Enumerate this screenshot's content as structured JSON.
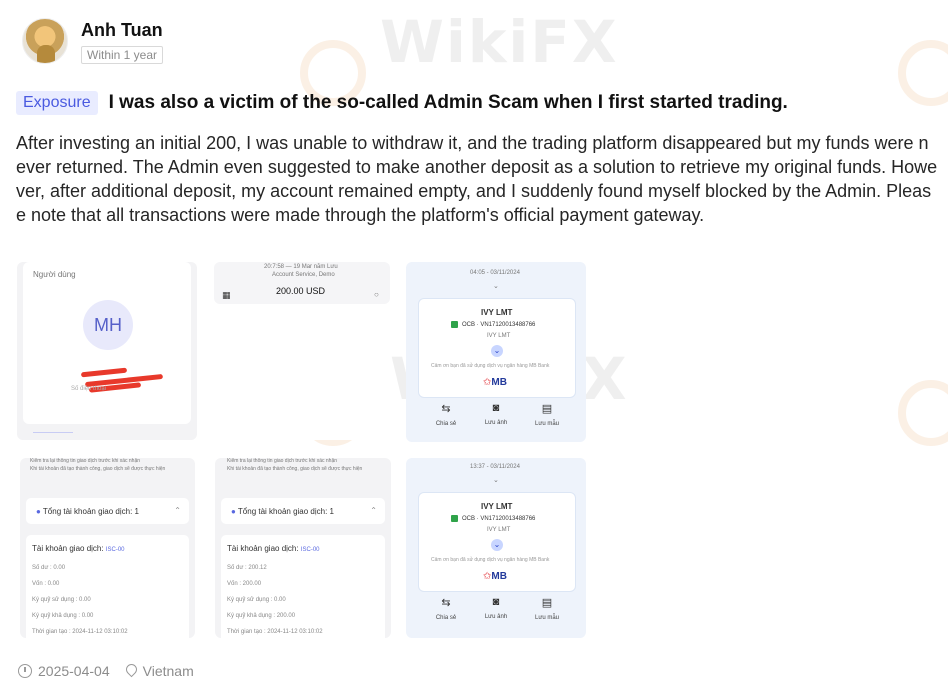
{
  "post": {
    "author": "Anh Tuan",
    "time_badge": "Within 1 year",
    "tag": "Exposure",
    "title": "I was also a victim of the so-called Admin Scam when I first started trading.",
    "body": "After investing an initial 200, I was unable to withdraw it, and the trading platform disappeared but my funds were never returned. The Admin even suggested to make another deposit as a solution to retrieve my original funds. However, after additional deposit, my account remained empty, and I suddenly found myself blocked by the Admin. Please note that all transactions were made through the platform's official payment gateway.",
    "date": "2025-04-04",
    "location": "Vietnam"
  },
  "watermark": "WikiFX",
  "screenshots": {
    "img1": {
      "label": "Người dùng",
      "initials": "MH",
      "sub": "Số điện thoại"
    },
    "img2": {
      "header": "20:7:58 — 19 Mar năm Lưu",
      "sub": "Account Service, Demo",
      "amount": "200.00 USD"
    },
    "img3": {
      "date": "04:05 - 03/11/2024",
      "name": "IVY LMT",
      "account": "OCB · VN17120013488766",
      "name2": "IVY LMT",
      "note": "Cảm ơn bạn đã sử dụng dịch vụ ngân hàng MB Bank",
      "bank": "MB",
      "actions": [
        "Chia sẻ",
        "Lưu ảnh",
        "Lưu mẫu"
      ]
    },
    "img4": {
      "note1": "Kiểm tra lại thông tin giao dịch trước khi xác nhận",
      "note2": "Khi tài khoản đã tạo thành công, giao dịch sẽ được thực hiện",
      "row": "Tổng tài khoản giao dịch: 1",
      "detail_title": "Tài khoản giao dịch:",
      "detail_tag": "ISC-00",
      "lines": [
        "Số dư : 0.00",
        "Vốn : 0.00",
        "Ký quỹ sử dụng : 0.00",
        "Ký quỹ khả dụng : 0.00",
        "Thời gian tạo : 2024-11-12 03:10:02"
      ]
    },
    "img5": {
      "note1": "Kiểm tra lại thông tin giao dịch trước khi xác nhận",
      "note2": "Khi tài khoản đã tạo thành công, giao dịch sẽ được thực hiện",
      "row": "Tổng tài khoản giao dịch: 1",
      "detail_title": "Tài khoản giao dịch:",
      "detail_tag": "ISC-00",
      "lines": [
        "Số dư : 200.12",
        "Vốn : 200.00",
        "Ký quỹ sử dụng : 0.00",
        "Ký quỹ khả dụng : 200.00",
        "Thời gian tạo : 2024-11-12 03:10:02"
      ]
    },
    "img6": {
      "date": "13:37 - 03/11/2024",
      "name": "IVY LMT",
      "account": "OCB · VN17120013488766",
      "name2": "IVY LMT",
      "note": "Cảm ơn bạn đã sử dụng dịch vụ ngân hàng MB Bank",
      "bank": "MB",
      "actions": [
        "Chia sẻ",
        "Lưu ảnh",
        "Lưu mẫu"
      ]
    }
  }
}
